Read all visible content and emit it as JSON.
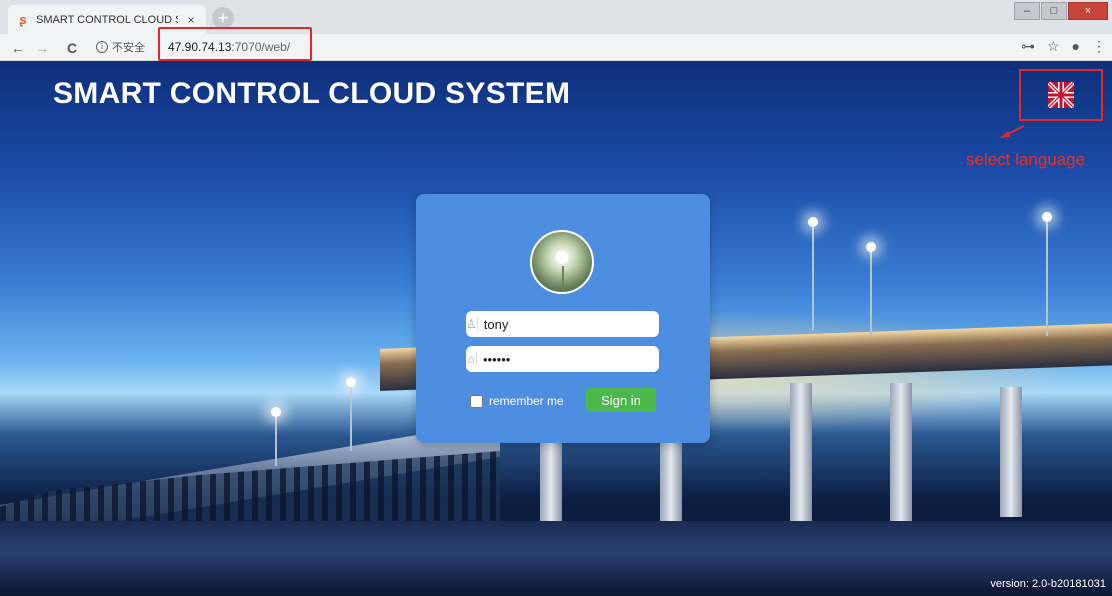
{
  "browser": {
    "tab_title": "SMART CONTROL CLOUD SYS",
    "tab_close": "×",
    "new_tab": "+",
    "back": "←",
    "forward": "→",
    "reload": "C",
    "security_label": "不安全",
    "url_host": "47.90.74.13",
    "url_path": ":7070/web/",
    "window_minimize": "–",
    "window_maximize": "□",
    "window_close": "×"
  },
  "page": {
    "title": "SMART CONTROL CLOUD SYSTEM",
    "annotation_text": "select language",
    "version": "version: 2.0-b20181031"
  },
  "login": {
    "username_value": "tony",
    "password_value": "••••••",
    "remember_label": "remember me",
    "signin_label": "Sign in"
  },
  "colors": {
    "card": "#4e8ee0",
    "signin": "#4cb84c",
    "annotation": "#e02a2a"
  }
}
